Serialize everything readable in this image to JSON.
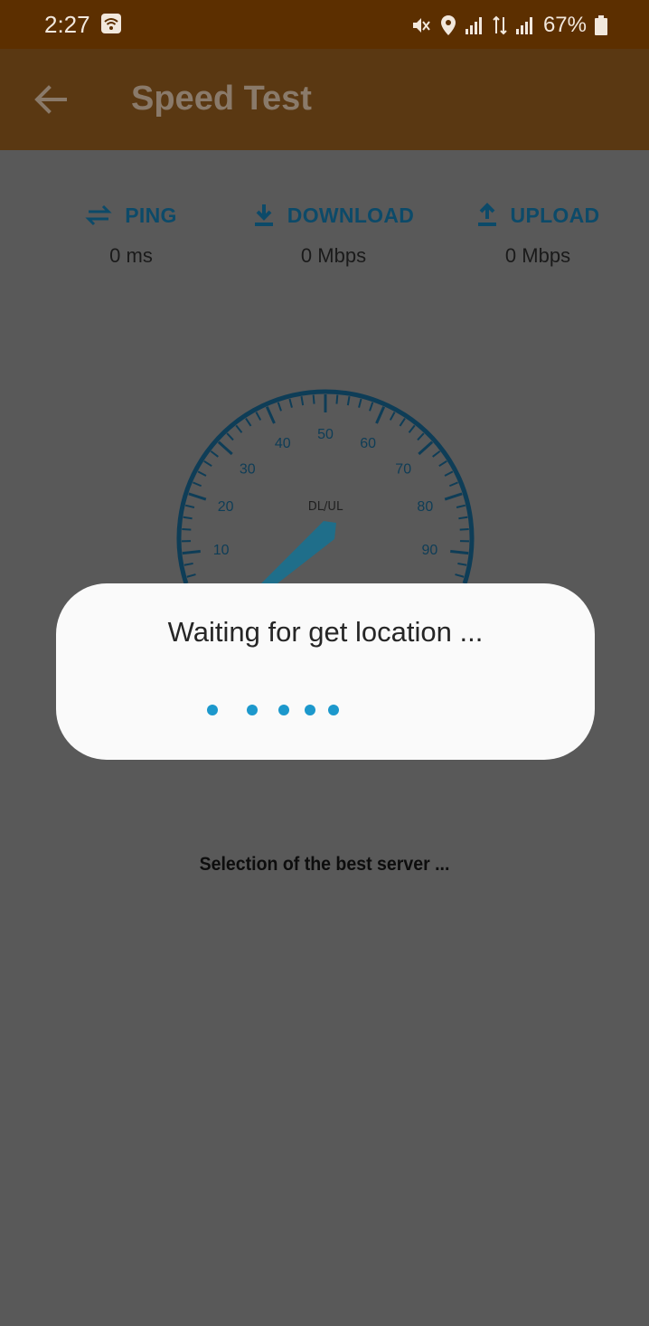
{
  "status_bar": {
    "time": "2:27",
    "battery_percent": "67%"
  },
  "app_bar": {
    "title": "Speed Test"
  },
  "metrics": {
    "ping": {
      "label": "PING",
      "value": "0 ms"
    },
    "download": {
      "label": "DOWNLOAD",
      "value": "0 Mbps"
    },
    "upload": {
      "label": "UPLOAD",
      "value": "0 Mbps"
    }
  },
  "gauge": {
    "center_label": "DL/UL",
    "tick_labels": [
      "10",
      "20",
      "30",
      "40",
      "50",
      "60",
      "70",
      "80",
      "90"
    ]
  },
  "dialog": {
    "message": "Waiting for get location ..."
  },
  "footer": {
    "server_status": "Selection of the best server ..."
  },
  "colors": {
    "status_bar_bg": "#5c2f00",
    "app_bar_bg": "#5a3812",
    "overlay_bg": "#595959",
    "accent": "#0c4a69",
    "loading_dot": "#1c98cc",
    "dialog_bg": "#fafafa"
  }
}
